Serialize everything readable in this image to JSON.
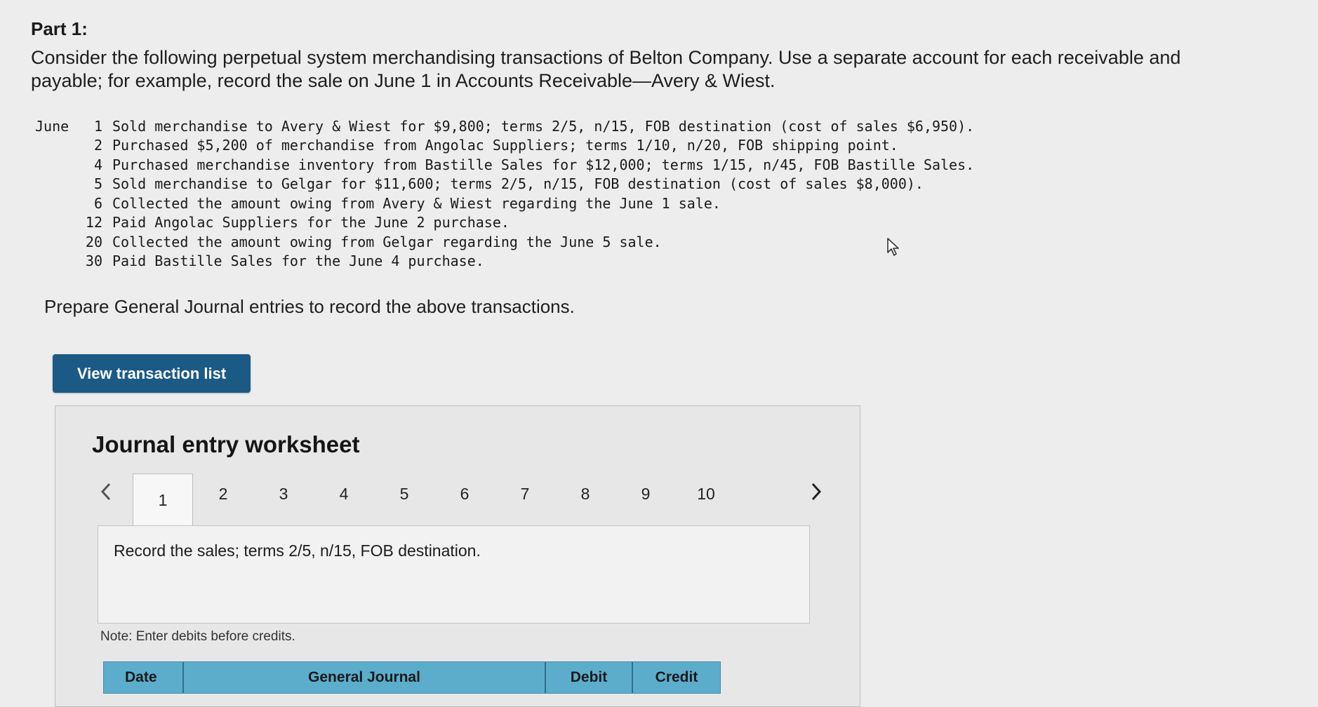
{
  "part_title": "Part 1:",
  "intro": "Consider the following perpetual system merchandising transactions of Belton Company. Use a separate account for each receivable and payable; for example, record the sale on June 1 in Accounts Receivable—Avery & Wiest.",
  "transactions": [
    {
      "month": "June",
      "day": "1",
      "text": "Sold merchandise to Avery & Wiest for $9,800; terms 2/5, n/15, FOB destination (cost of sales $6,950)."
    },
    {
      "month": "",
      "day": "2",
      "text": "Purchased $5,200 of merchandise from Angolac Suppliers; terms 1/10, n/20, FOB shipping point."
    },
    {
      "month": "",
      "day": "4",
      "text": "Purchased merchandise inventory from Bastille Sales for $12,000; terms 1/15, n/45, FOB Bastille Sales."
    },
    {
      "month": "",
      "day": "5",
      "text": "Sold merchandise to Gelgar for $11,600; terms 2/5, n/15, FOB destination (cost of sales $8,000)."
    },
    {
      "month": "",
      "day": "6",
      "text": "Collected the amount owing from Avery & Wiest regarding the June 1 sale."
    },
    {
      "month": "",
      "day": "12",
      "text": "Paid Angolac Suppliers for the June 2 purchase."
    },
    {
      "month": "",
      "day": "20",
      "text": "Collected the amount owing from Gelgar regarding the June 5 sale."
    },
    {
      "month": "",
      "day": "30",
      "text": "Paid Bastille Sales for the June 4 purchase."
    }
  ],
  "prompt": "Prepare General Journal entries to record the above transactions.",
  "view_button_label": "View transaction list",
  "worksheet": {
    "title": "Journal entry worksheet",
    "tabs": [
      "1",
      "2",
      "3",
      "4",
      "5",
      "6",
      "7",
      "8",
      "9",
      "10"
    ],
    "active_tab": "1",
    "instruction": "Record the sales; terms 2/5, n/15, FOB destination.",
    "note": "Note: Enter debits before credits.",
    "table_headers": {
      "date": "Date",
      "journal": "General Journal",
      "debit": "Debit",
      "credit": "Credit"
    }
  },
  "icons": {
    "prev": "chevron-left-icon",
    "next": "chevron-right-icon",
    "cursor": "mouse-pointer-icon"
  },
  "colors": {
    "button": "#1c5a86",
    "table_header": "#5cadcc"
  }
}
